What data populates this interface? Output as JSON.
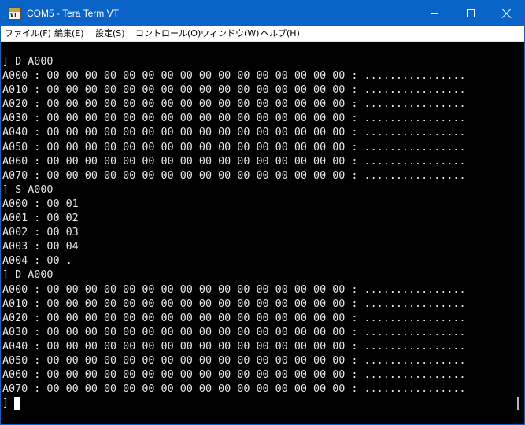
{
  "window": {
    "title": "COM5 - Tera Term VT",
    "icon": "vt-terminal-icon",
    "icon_text": "VT"
  },
  "menu": [
    {
      "label": "ファイル(F)"
    },
    {
      "label": "編集(E)"
    },
    {
      "label": "設定(S)"
    },
    {
      "label": "コントロール(O)"
    },
    {
      "label": "ウィンドウ(W)"
    },
    {
      "label": "ヘルプ(H)"
    }
  ],
  "terminal": {
    "lines": [
      "] D A000",
      "A000 : 00 00 00 00 00 00 00 00 00 00 00 00 00 00 00 00 : ................",
      "A010 : 00 00 00 00 00 00 00 00 00 00 00 00 00 00 00 00 : ................",
      "A020 : 00 00 00 00 00 00 00 00 00 00 00 00 00 00 00 00 : ................",
      "A030 : 00 00 00 00 00 00 00 00 00 00 00 00 00 00 00 00 : ................",
      "A040 : 00 00 00 00 00 00 00 00 00 00 00 00 00 00 00 00 : ................",
      "A050 : 00 00 00 00 00 00 00 00 00 00 00 00 00 00 00 00 : ................",
      "A060 : 00 00 00 00 00 00 00 00 00 00 00 00 00 00 00 00 : ................",
      "A070 : 00 00 00 00 00 00 00 00 00 00 00 00 00 00 00 00 : ................",
      "] S A000",
      "A000 : 00 01",
      "A001 : 00 02",
      "A002 : 00 03",
      "A003 : 00 04",
      "A004 : 00 .",
      "] D A000",
      "A000 : 00 00 00 00 00 00 00 00 00 00 00 00 00 00 00 00 : ................",
      "A010 : 00 00 00 00 00 00 00 00 00 00 00 00 00 00 00 00 : ................",
      "A020 : 00 00 00 00 00 00 00 00 00 00 00 00 00 00 00 00 : ................",
      "A030 : 00 00 00 00 00 00 00 00 00 00 00 00 00 00 00 00 : ................",
      "A040 : 00 00 00 00 00 00 00 00 00 00 00 00 00 00 00 00 : ................",
      "A050 : 00 00 00 00 00 00 00 00 00 00 00 00 00 00 00 00 : ................",
      "A060 : 00 00 00 00 00 00 00 00 00 00 00 00 00 00 00 00 : ................",
      "A070 : 00 00 00 00 00 00 00 00 00 00 00 00 00 00 00 00 : ................",
      "]"
    ]
  },
  "colors": {
    "titlebar": "#0a64c8",
    "terminal_bg": "#000000",
    "terminal_fg": "#e6e6e6"
  }
}
